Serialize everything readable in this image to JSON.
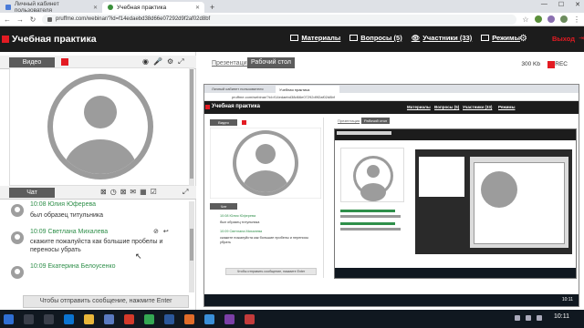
{
  "browser": {
    "tabs": [
      {
        "title": "Личный кабинет пользователя",
        "active": false
      },
      {
        "title": "Учебная практика",
        "active": true
      }
    ],
    "new_tab": "+",
    "url": "pruffme.com/webinar/?id=f14edaebd38d66e07292d9f2af02d8bf",
    "window_controls": [
      "—",
      "☐",
      "✕"
    ]
  },
  "header": {
    "title": "Учебная практика",
    "menu": [
      "Материалы",
      "Вопросы (5)",
      "Участники (33)",
      "Режимы"
    ],
    "logout": "Выход"
  },
  "left_panel": {
    "video_button": "Видео",
    "chat_button": "Чат",
    "messages": [
      {
        "meta": "10:08 Юлия Юферева",
        "text": "был образец титульника"
      },
      {
        "meta": "10:09 Светлана Михалева",
        "text": "скажите пожалуйста как большие пробелы и переносы убрать"
      },
      {
        "meta": "10:09 Екатерина Белоусенко",
        "text": ""
      }
    ],
    "chat_placeholder": "Чтобы отправить сообщение, нажмите Enter"
  },
  "right_panel": {
    "tabs": [
      "Презентация",
      "Рабочий стол"
    ],
    "active_tab": "Рабочий стол",
    "bitrate": "300 Kb",
    "rec": "REC"
  },
  "screenshare": {
    "url": "pruffme.com/webinar/?id=f14edaebd38d66e07292d9f2af02d8bf",
    "title": "Учебная практика",
    "menu": [
      "Материалы",
      "Вопросы (5)",
      "Участники (33)",
      "Режимы"
    ],
    "video_button": "Видео",
    "chat_button": "Чат",
    "tabs": [
      "Презентация",
      "Рабочий стол"
    ],
    "messages": [
      {
        "meta": "10:08 Юлия Юферева",
        "text": "был образец титульника"
      },
      {
        "meta": "10:09 Светлана Михалева",
        "text": "скажите пожалуйста как большие пробелы и переносы убрать"
      }
    ],
    "chat_placeholder": "Чтобы отправить сообщение, нажмите Enter"
  },
  "taskbar": {
    "time": "10:11"
  },
  "colors": {
    "accent_red": "#e31b23",
    "header_bg": "#1c1c1c",
    "timestamp_green": "#2f8f4a"
  }
}
